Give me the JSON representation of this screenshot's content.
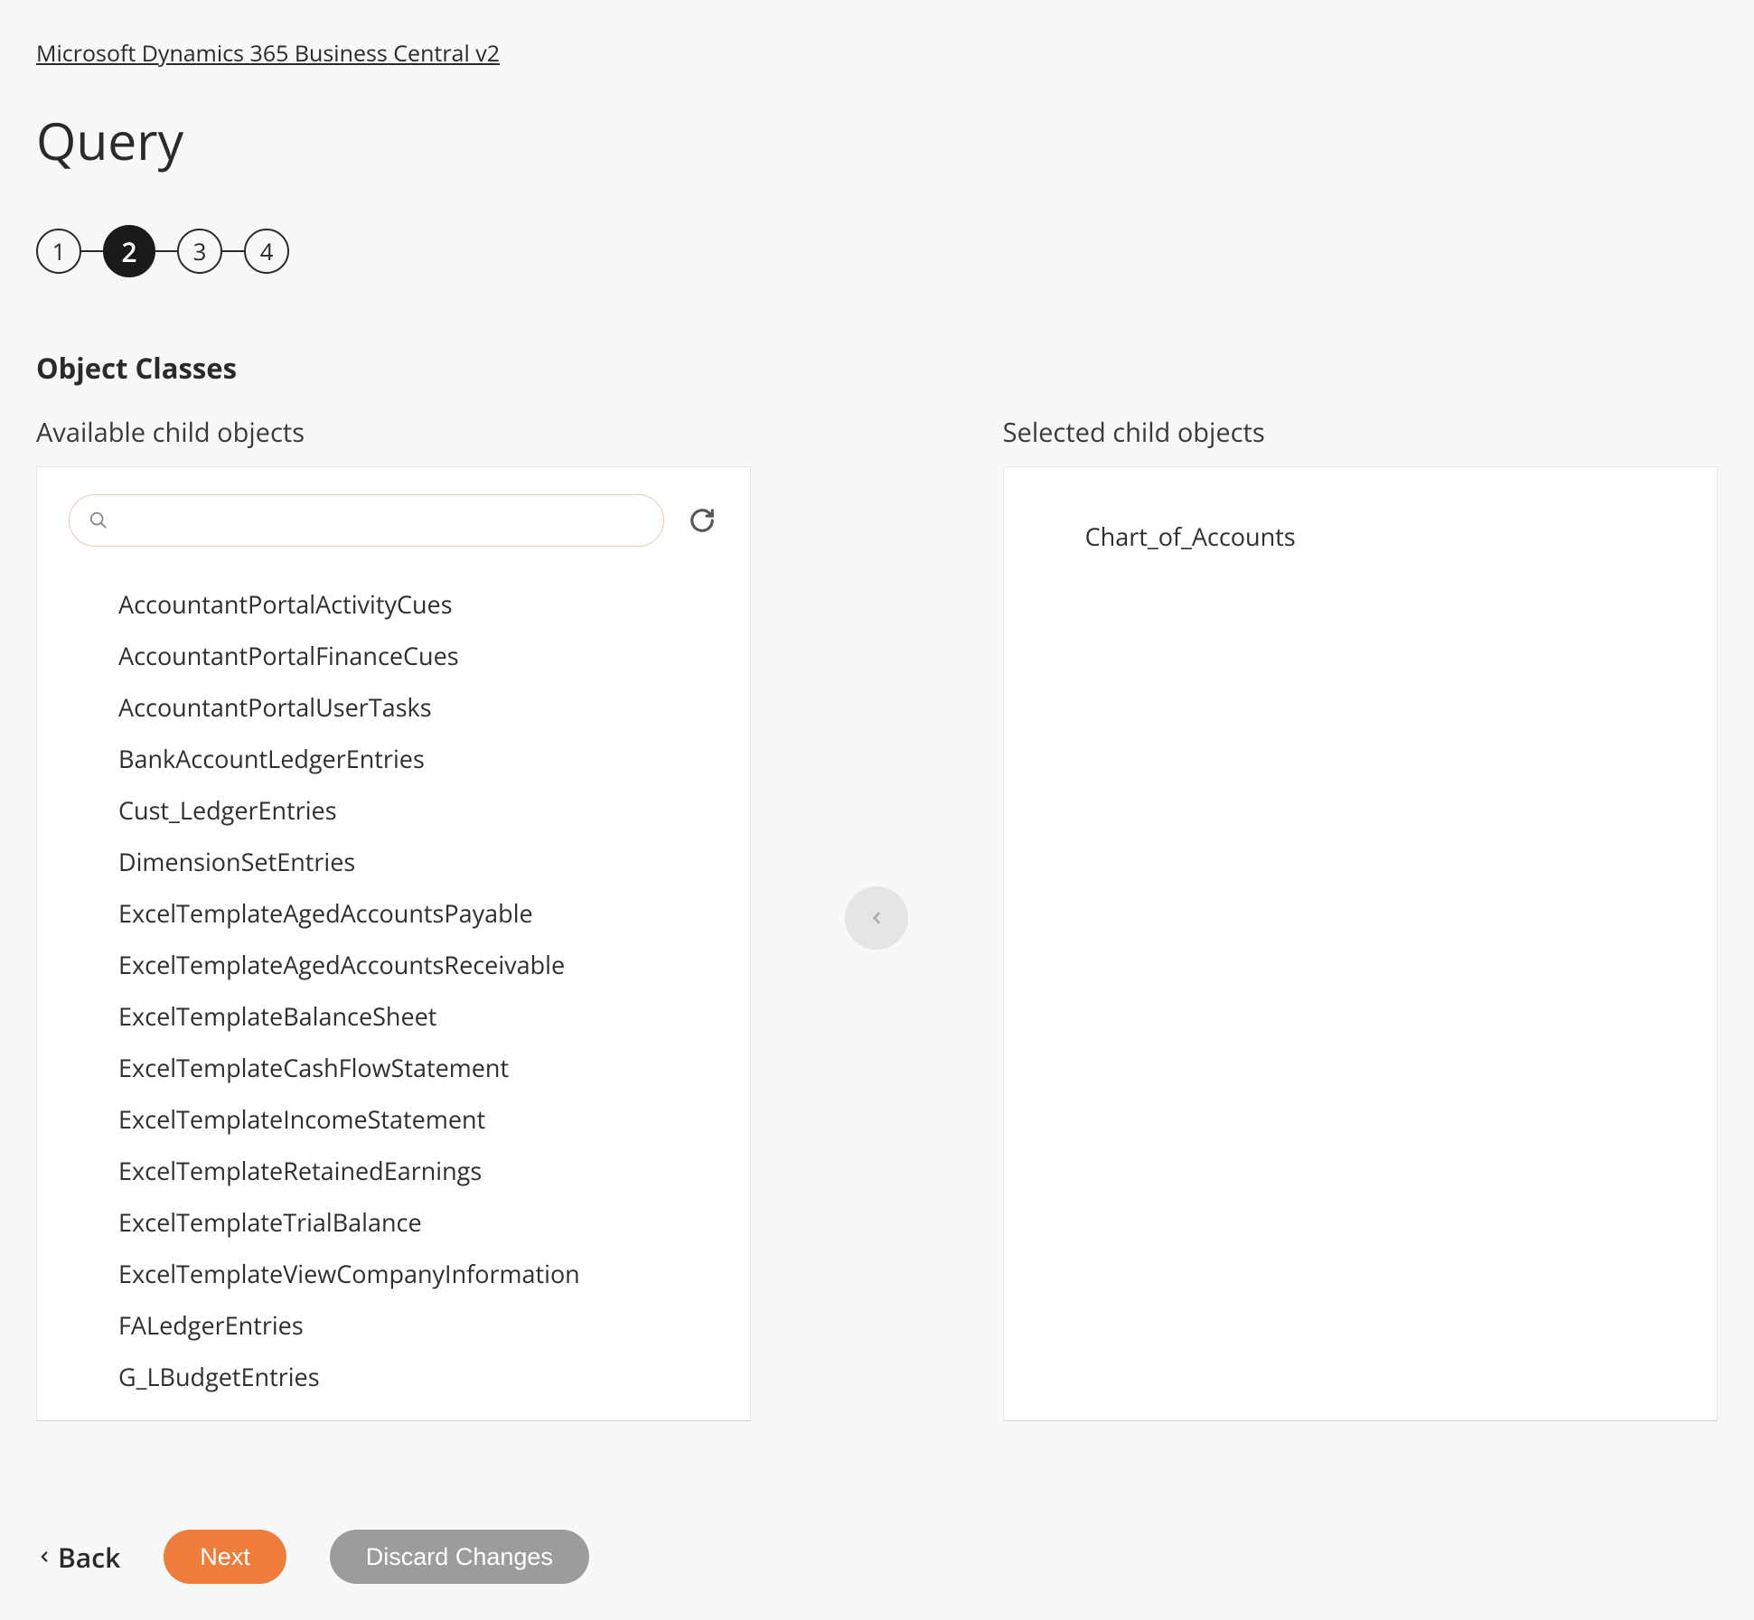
{
  "breadcrumb": "Microsoft Dynamics 365 Business Central v2",
  "pageTitle": "Query",
  "stepper": {
    "steps": [
      "1",
      "2",
      "3",
      "4"
    ],
    "active": 1
  },
  "sectionTitle": "Object Classes",
  "leftPanel": {
    "label": "Available child objects",
    "search": {
      "value": ""
    },
    "items": [
      "AccountantPortalActivityCues",
      "AccountantPortalFinanceCues",
      "AccountantPortalUserTasks",
      "BankAccountLedgerEntries",
      "Cust_LedgerEntries",
      "DimensionSetEntries",
      "ExcelTemplateAgedAccountsPayable",
      "ExcelTemplateAgedAccountsReceivable",
      "ExcelTemplateBalanceSheet",
      "ExcelTemplateCashFlowStatement",
      "ExcelTemplateIncomeStatement",
      "ExcelTemplateRetainedEarnings",
      "ExcelTemplateTrialBalance",
      "ExcelTemplateViewCompanyInformation",
      "FALedgerEntries",
      "G_LBudgetEntries"
    ]
  },
  "rightPanel": {
    "label": "Selected child objects",
    "items": [
      "Chart_of_Accounts"
    ]
  },
  "footer": {
    "back": "Back",
    "next": "Next",
    "discard": "Discard Changes"
  }
}
